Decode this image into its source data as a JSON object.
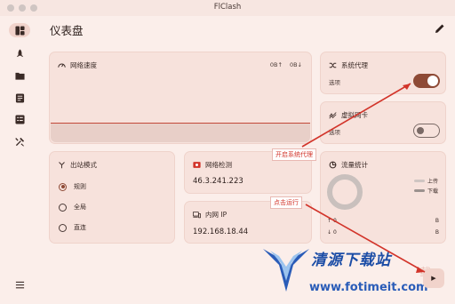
{
  "window": {
    "title": "FlClash"
  },
  "sidebar": {
    "items": [
      {
        "name": "dashboard",
        "icon": "dashboard-icon",
        "active": true
      },
      {
        "name": "proxies",
        "icon": "rocket-icon",
        "active": false
      },
      {
        "name": "profiles",
        "icon": "folder-icon",
        "active": false
      },
      {
        "name": "requests",
        "icon": "list-icon",
        "active": false
      },
      {
        "name": "connections",
        "icon": "table-icon",
        "active": false
      },
      {
        "name": "tools",
        "icon": "tools-icon",
        "active": false
      }
    ],
    "menu_icon": "menu-icon"
  },
  "header": {
    "title": "仪表盘",
    "edit_icon": "pencil-icon"
  },
  "network_speed": {
    "title": "网络速度",
    "upload": "0B↑",
    "download": "0B↓",
    "line_color": "#c2493a"
  },
  "system_proxy": {
    "title": "系统代理",
    "option_label": "选项",
    "enabled": true
  },
  "tun": {
    "title": "虚拟网卡",
    "option_label": "选项",
    "enabled": false
  },
  "outbound_mode": {
    "title": "出站模式",
    "options": [
      {
        "label": "规则",
        "checked": true
      },
      {
        "label": "全局",
        "checked": false
      },
      {
        "label": "直连",
        "checked": false
      }
    ]
  },
  "network_check": {
    "title": "网络检测",
    "value": "46.3.241.223"
  },
  "intranet_ip": {
    "title": "内网 IP",
    "value": "192.168.18.44"
  },
  "traffic": {
    "title": "流量统计",
    "legend_upload": "上传",
    "legend_download": "下载",
    "up_label": "↑",
    "up_value": "0",
    "up_unit": "B",
    "down_label": "↓",
    "down_value": "0",
    "down_unit": "B"
  },
  "annotations": {
    "enable_proxy": "开启系统代理",
    "click_run": "点击运行"
  },
  "watermark": {
    "cn": "清源下载站",
    "url": "www.fotimeit.com",
    "ghost": "载"
  },
  "run_button": {
    "icon": "play-icon",
    "label": "▶"
  },
  "colors": {
    "accent": "#8e4a36",
    "background": "#fbeeea",
    "card": "#f7e2dc",
    "annotation": "#d2342a"
  }
}
